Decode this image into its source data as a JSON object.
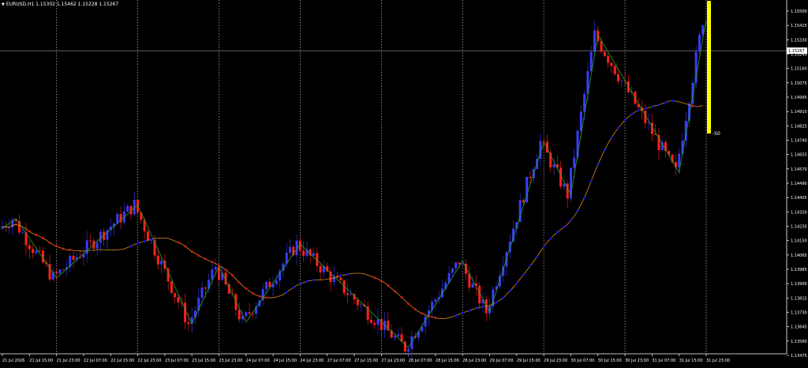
{
  "window": {
    "title": "EURUSD,H1  1.15302 1.15462 1.15228 1.15267",
    "title_icon": "triangle-down-icon"
  },
  "colors": {
    "background": "#000000",
    "bull_candle": "#3a3aff",
    "bear_candle": "#ff2020",
    "zigzag": "#1fa51f",
    "moving_average": "#d98a1c",
    "dots_up": "#1010ff",
    "dots_down": "#e01010",
    "grid": "#bbbbbb",
    "price_line": "#9a9a9a",
    "histogram": "#ffff00",
    "axis_text": "#ffffff"
  },
  "chart_data": {
    "type": "candlestick",
    "symbol": "EURUSD",
    "timeframe": "H1",
    "header_values": {
      "open": 1.15302,
      "high": 1.15462,
      "low": 1.15228,
      "close": 1.15267
    },
    "ylim": [
      1.1343,
      1.1556
    ],
    "y_ticks": [
      "1.15500",
      "1.15415",
      "1.15330",
      "1.15245",
      "1.15160",
      "1.15075",
      "1.14995",
      "1.14910",
      "1.14825",
      "1.14740",
      "1.14655",
      "1.14570",
      "1.14490",
      "1.14405",
      "1.14320",
      "1.14235",
      "1.14150",
      "1.14065",
      "1.13985",
      "1.13900",
      "1.13815",
      "1.13730",
      "1.13645",
      "1.13560",
      "1.13475"
    ],
    "current_price": "1.15267",
    "x_ticks": [
      "21 Jul 2026",
      "21 Jul 15:00",
      "21 Jul 23:00",
      "22 Jul 07:00",
      "22 Jul 15:00",
      "22 Jul 23:00",
      "23 Jul 07:00",
      "23 Jul 15:00",
      "23 Jul 23:00",
      "24 Jul 07:00",
      "24 Jul 15:00",
      "24 Jul 23:00",
      "27 Jul 07:00",
      "27 Jul 15:00",
      "27 Jul 23:00",
      "28 Jul 07:00",
      "28 Jul 15:00",
      "28 Jul 23:00",
      "29 Jul 07:00",
      "29 Jul 15:00",
      "29 Jul 23:00",
      "30 Jul 07:00",
      "30 Jul 15:00",
      "30 Jul 23:00",
      "31 Jul 07:00",
      "31 Jul 15:00",
      "31 Jul 23:00"
    ],
    "separators": [
      "21 Jul 23:00",
      "22 Jul 23:00",
      "23 Jul 23:00",
      "24 Jul 23:00",
      "27 Jul 23:00",
      "28 Jul 23:00",
      "29 Jul 23:00",
      "30 Jul 23:00",
      "31 Jul 23:00"
    ],
    "zigzag": [
      {
        "t": "21 Jul 2026",
        "p": 1.1422
      },
      {
        "t": "21 Jul 11:00",
        "p": 1.1428
      },
      {
        "t": "21 Jul 23:00",
        "p": 1.1393
      },
      {
        "t": "22 Jul 23:00",
        "p": 1.1436
      },
      {
        "t": "23 Jul 15:00",
        "p": 1.1366
      },
      {
        "t": "23 Jul 23:00",
        "p": 1.14
      },
      {
        "t": "24 Jul 07:00",
        "p": 1.1367
      },
      {
        "t": "24 Jul 23:00",
        "p": 1.1413
      },
      {
        "t": "28 Jul 07:00",
        "p": 1.1352
      },
      {
        "t": "28 Jul 23:00",
        "p": 1.1403
      },
      {
        "t": "29 Jul 07:00",
        "p": 1.1373
      },
      {
        "t": "29 Jul 23:00",
        "p": 1.1473
      },
      {
        "t": "30 Jul 07:00",
        "p": 1.1442
      },
      {
        "t": "30 Jul 15:00",
        "p": 1.1536
      },
      {
        "t": "31 Jul 15:00",
        "p": 1.1455
      },
      {
        "t": "31 Jul 23:00",
        "p": 1.1545
      }
    ],
    "histogram": {
      "label": "-50",
      "value": -50,
      "top": 1.1556,
      "bottom": 1.1478
    }
  }
}
